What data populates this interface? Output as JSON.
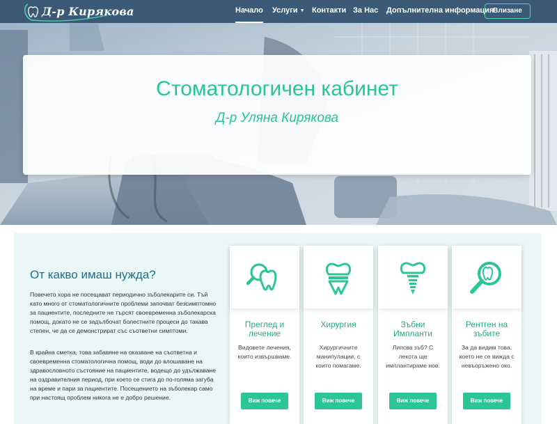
{
  "brand": {
    "logo_text": "Д-р Кирякова"
  },
  "nav": {
    "items": [
      "Начало",
      "Услуги",
      "Контакти",
      "За Нас",
      "Допълнителна информация"
    ],
    "active": "Начало",
    "login_label": "Влизане"
  },
  "hero": {
    "title": "Стоматологичен кабинет",
    "subtitle": "Д-р Уляна Кирякова"
  },
  "intro": {
    "heading": "От какво имаш нужда?",
    "paragraph1": "Повечето хора не посещават периодично зъболекарите си. Тъй като много от стоматологичните проблеми започват безсимптомно за пациентите, последните не търсят своевременна зъболекарска помощ, докато не се задълбочат болестните процеси до такава степен, че да се демонстрират със съответни симптоми.",
    "paragraph2": "В крайна сметка, това забавяне на оказване на съответна и своевременна стоматологична помощ, води до влошаване на здравословното състояние на пациентите, водещо до удължаване на оздравителния период, при което се стига до по-голяма загуба на време и пари за пациентите. Посещението на зъболекар само при настоящ проблем никога не е добро решение."
  },
  "services": [
    {
      "icon": "tooth-search-icon",
      "title": "Преглед и лечение",
      "description": "Видовете лечения, които извършваме.",
      "button": "Виж повече"
    },
    {
      "icon": "tooth-crown-icon",
      "title": "Хирургия",
      "description": "Хирургичните манипулации, с които помагаме.",
      "button": "Виж повече"
    },
    {
      "icon": "dental-implant-icon",
      "title": "Зъбни Импланти",
      "description": "Липсва зъб? С лекота ще имплантираме нов.",
      "button": "Виж повече"
    },
    {
      "icon": "xray-magnifier-icon",
      "title": "Рентген на зъбите",
      "description": "За да видим това, което не се вижда с невъоръжено око.",
      "button": "Виж повече"
    }
  ],
  "colors": {
    "navbar": "#3a5a78",
    "accent": "#27c498",
    "heading_blue": "#1e6e8e",
    "panel": "#e9f7f6"
  }
}
